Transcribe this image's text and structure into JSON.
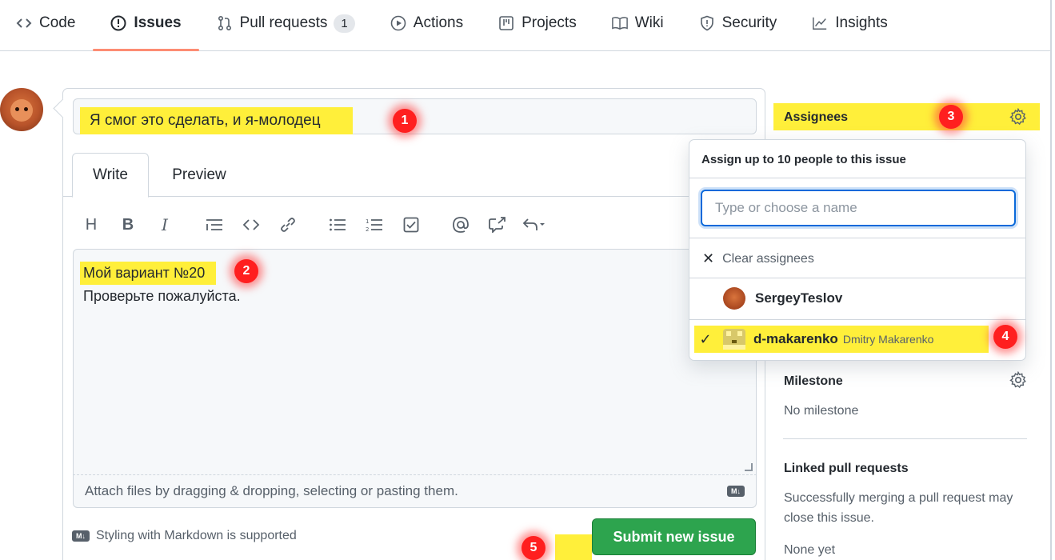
{
  "nav": {
    "items": [
      {
        "label": "Code",
        "icon": "code-icon"
      },
      {
        "label": "Issues",
        "icon": "issue-opened-icon",
        "active": true
      },
      {
        "label": "Pull requests",
        "icon": "git-pull-request-icon",
        "count": "1"
      },
      {
        "label": "Actions",
        "icon": "play-icon"
      },
      {
        "label": "Projects",
        "icon": "project-icon"
      },
      {
        "label": "Wiki",
        "icon": "book-icon"
      },
      {
        "label": "Security",
        "icon": "shield-icon"
      },
      {
        "label": "Insights",
        "icon": "graph-icon"
      }
    ]
  },
  "form": {
    "title_value": "Я смог это сделать, и я-молодец",
    "tabs": {
      "write": "Write",
      "preview": "Preview"
    },
    "toolbar": [
      "H",
      "B",
      "I",
      "quote",
      "code",
      "link",
      "ul",
      "ol",
      "task",
      "mention",
      "reference",
      "undo"
    ],
    "body_line1": "Мой вариант №20",
    "body_line2": "Проверьте пожалуйста.",
    "attach_text": "Attach files by dragging & dropping, selecting or pasting them.",
    "markdown_badge": "M↓",
    "markdown_support": "Styling with Markdown is supported",
    "submit_label": "Submit new issue"
  },
  "badges": {
    "b1": "1",
    "b2": "2",
    "b3": "3",
    "b4": "4",
    "b5": "5"
  },
  "sidebar": {
    "assignees_label": "Assignees",
    "milestone_label": "Milestone",
    "milestone_value": "No milestone",
    "linked_label": "Linked pull requests",
    "linked_text": "Successfully merging a pull request may close this issue.",
    "linked_value": "None yet"
  },
  "dropdown": {
    "header": "Assign up to 10 people to this issue",
    "search_placeholder": "Type or choose a name",
    "clear_label": "Clear assignees",
    "users": [
      {
        "username": "SergeyTeslov",
        "fullname": "",
        "selected": false
      },
      {
        "username": "d-makarenko",
        "fullname": "Dmitry Makarenko",
        "selected": true
      }
    ]
  },
  "colors": {
    "highlight": "#ffef3a",
    "submit": "#2da44e",
    "badge": "#ff1f1f",
    "focus": "#0969da"
  }
}
